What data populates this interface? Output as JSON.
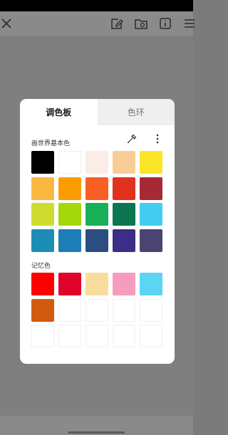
{
  "tabs": [
    {
      "label": "调色板",
      "active": true
    },
    {
      "label": "色环",
      "active": false
    }
  ],
  "basic_colors_label": "画世界基本色",
  "memory_colors_label": "记忆色",
  "icons": {
    "close": "close-icon",
    "eyedropper": "eyedropper-icon",
    "more": "more-vertical-icon"
  },
  "basic_colors": [
    "#000000",
    "#ffffff",
    "#fcece6",
    "#f9cd96",
    "#fbe528",
    "#f9b941",
    "#fb9d02",
    "#f95f23",
    "#e0321f",
    "#a52a36",
    "#cddc2f",
    "#a4d80a",
    "#17b057",
    "#0b7650",
    "#42cdf1",
    "#1d8db4",
    "#1c7db8",
    "#2b4d7f",
    "#3b2e88",
    "#4b4472"
  ],
  "memory_colors": [
    "#ff0000",
    "#e0032a",
    "#f8dd9c",
    "#f69dbf",
    "#5cd4f3",
    "#d25a0e",
    "",
    "",
    "",
    "",
    "",
    "",
    "",
    "",
    ""
  ]
}
